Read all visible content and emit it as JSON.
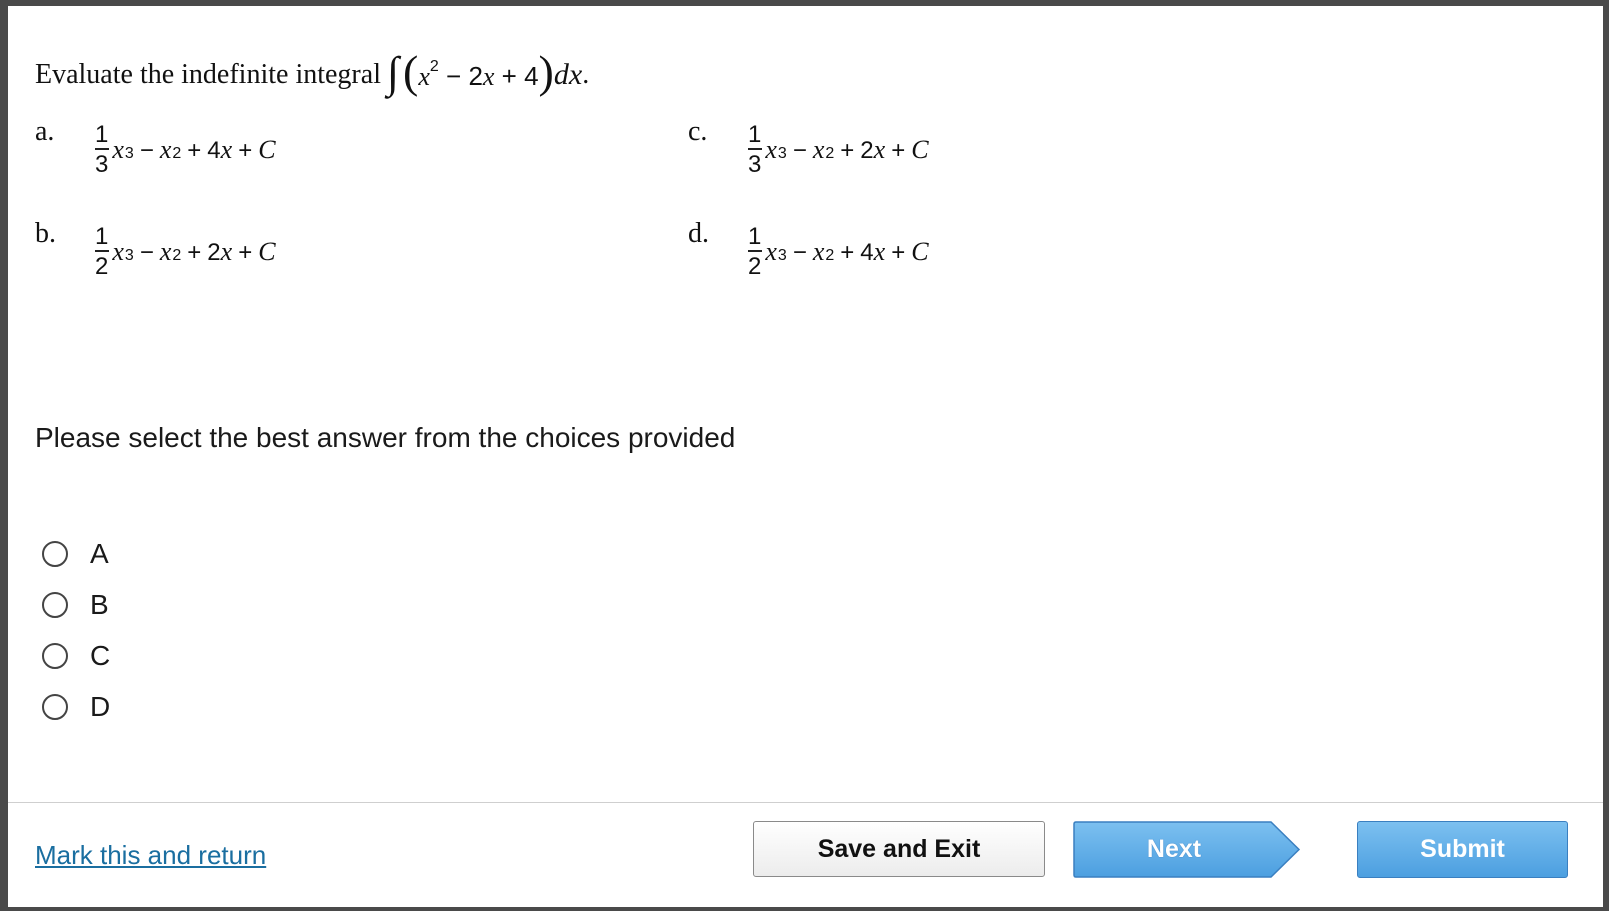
{
  "question": {
    "text": "Evaluate the indefinite integral",
    "integral_sign": "∫",
    "open_paren": "(",
    "close_paren": ")",
    "var_x": "x",
    "exp_2": "2",
    "mid": " − 2",
    "mid_end": " + 4",
    "dx": "dx",
    "period": "."
  },
  "choices": [
    {
      "letter": "a.",
      "num": "1",
      "den": "3",
      "pow1": "3",
      "pow2": "2",
      "coef": "4"
    },
    {
      "letter": "b.",
      "num": "1",
      "den": "2",
      "pow1": "3",
      "pow2": "2",
      "coef": "2"
    },
    {
      "letter": "c.",
      "num": "1",
      "den": "3",
      "pow1": "3",
      "pow2": "2",
      "coef": "2"
    },
    {
      "letter": "d.",
      "num": "1",
      "den": "2",
      "pow1": "3",
      "pow2": "2",
      "coef": "4"
    }
  ],
  "symbols": {
    "minus": "−",
    "plus": "+",
    "x": "x",
    "C": "C"
  },
  "instruction": "Please select the best answer from the choices provided",
  "options": [
    "A",
    "B",
    "C",
    "D"
  ],
  "footer": {
    "mark_link": "Mark this and return",
    "save_label": "Save and Exit",
    "next_label": "Next",
    "submit_label": "Submit"
  },
  "colors": {
    "link": "#1a6ea0",
    "primary_button": "#5aaae6",
    "frame": "#4a4a4a"
  }
}
